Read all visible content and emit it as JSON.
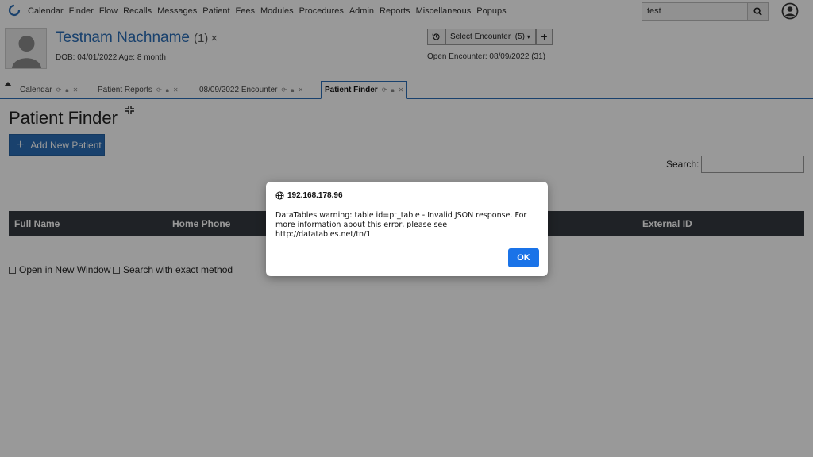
{
  "nav": {
    "items": [
      "Calendar",
      "Finder",
      "Flow",
      "Recalls",
      "Messages",
      "Patient",
      "Fees",
      "Modules",
      "Procedures",
      "Admin",
      "Reports",
      "Miscellaneous",
      "Popups"
    ],
    "search_value": "test"
  },
  "patient": {
    "name": "Testnam Nachname",
    "count": "(1)",
    "close": "×",
    "dob": "DOB: 04/01/2022 Age: 8 month"
  },
  "encounter": {
    "select_label": "Select Encounter",
    "select_count": "(5)",
    "add": "+",
    "open": "Open Encounter: 08/09/2022 (31)"
  },
  "tabs": [
    {
      "label": "Calendar"
    },
    {
      "label": "Patient Reports"
    },
    {
      "label": "08/09/2022 Encounter"
    },
    {
      "label": "Patient Finder"
    }
  ],
  "main": {
    "title": "Patient Finder",
    "add_button": "Add New Patient",
    "search_label": "Search:",
    "columns": [
      "Full Name",
      "Home Phone",
      "External ID"
    ],
    "open_new_window": "Open in New Window",
    "exact_method": "Search with exact method"
  },
  "dialog": {
    "origin": "192.168.178.96",
    "message": "DataTables warning: table id=pt_table - Invalid JSON response. For more information about this error, please see http://datatables.net/tn/1",
    "ok": "OK"
  },
  "colors": {
    "accent": "#2a6db6",
    "table_header": "#343a40",
    "ok_button": "#1a73e8"
  }
}
